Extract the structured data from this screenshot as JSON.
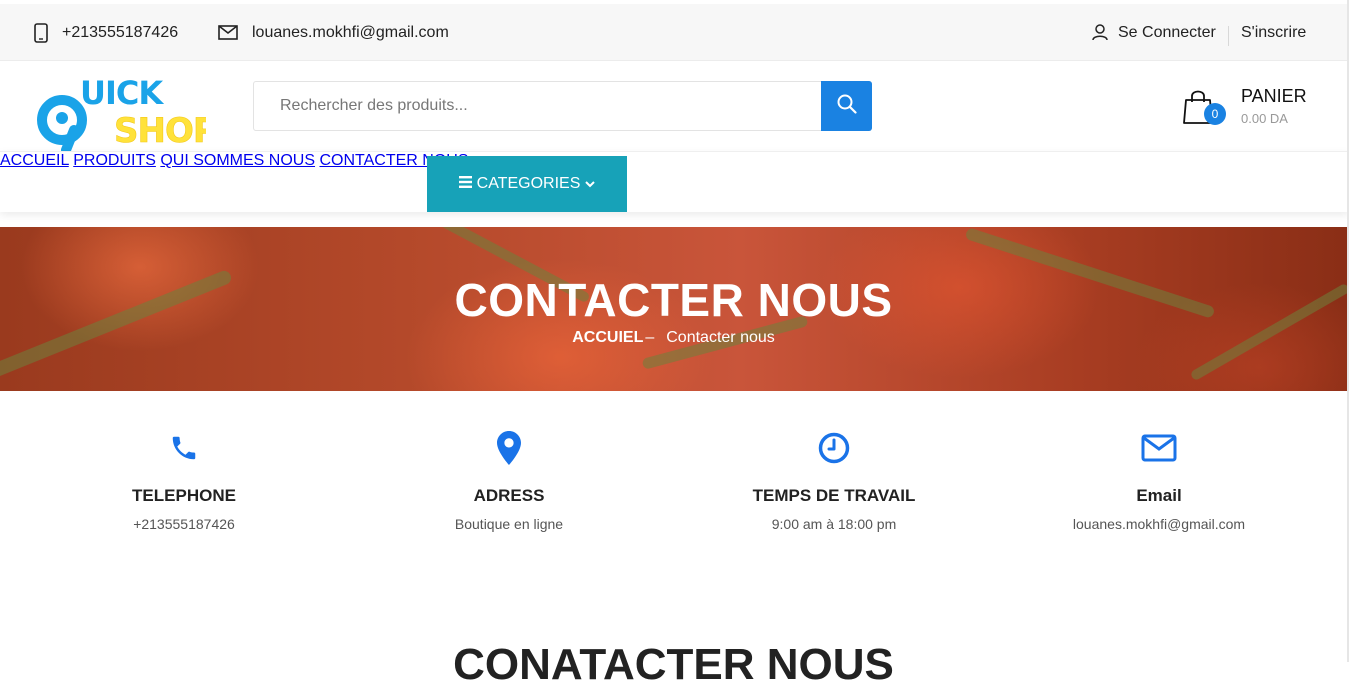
{
  "topbar": {
    "phone": "+213555187426",
    "email": "louanes.mokhfi@gmail.com",
    "login": "Se Connecter",
    "signup": "S'inscrire"
  },
  "logo": {
    "line1": "UICK",
    "line2": "SHOP",
    "letter": "Q",
    "colors": {
      "blue": "#1aa3e8",
      "yellow": "#ffe23a"
    }
  },
  "search": {
    "placeholder": "Rechercher des produits..."
  },
  "cart": {
    "title": "PANIER",
    "amount": "0.00 DA",
    "count": "0"
  },
  "nav": {
    "categories": "CATEGORIES",
    "links": [
      "ACCUEIL",
      "PRODUITS",
      "QUI SOMMES NOUS",
      "CONTACTER NOUS"
    ]
  },
  "banner": {
    "title": "CONTACTER NOUS",
    "breadcrumb_home": "ACCUIEL",
    "breadcrumb_sep": "–",
    "breadcrumb_current": "Contacter nous"
  },
  "info": [
    {
      "icon": "phone-icon",
      "title": "TELEPHONE",
      "value": "+213555187426"
    },
    {
      "icon": "location-pin-icon",
      "title": "ADRESS",
      "value": "Boutique en ligne"
    },
    {
      "icon": "clock-icon",
      "title": "TEMPS DE TRAVAIL",
      "value": "9:00 am à 18:00 pm"
    },
    {
      "icon": "envelope-icon",
      "title": "Email",
      "value": "louanes.mokhfi@gmail.com"
    }
  ],
  "section_title": "CONATACTER NOUS",
  "colors": {
    "accent_blue": "#1a82e2",
    "categories_teal": "#17a2b8",
    "icon_blue": "#1a73e8"
  }
}
